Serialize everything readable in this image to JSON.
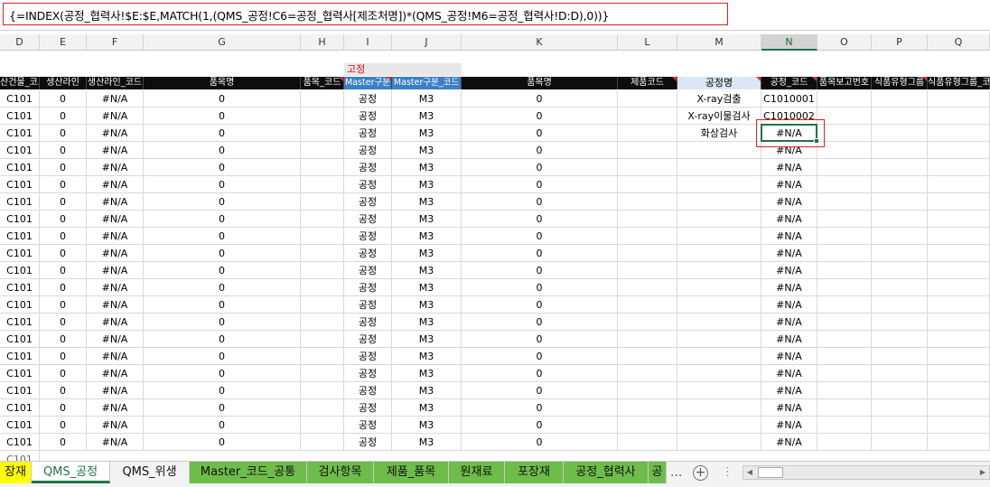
{
  "formula": "{=INDEX(공정_협력사!$E:$E,MATCH(1,(QMS_공정!C6=공정_협력사[제조처명])*(QMS_공정!M6=공정_협력사!D:D),0))}",
  "column_letters": [
    "D",
    "E",
    "F",
    "G",
    "H",
    "I",
    "J",
    "K",
    "L",
    "M",
    "N",
    "O",
    "P",
    "Q"
  ],
  "active_column": "N",
  "fixed_label": "고정",
  "headers": [
    "산건물_코드",
    "생산라인",
    "생산라인_코드",
    "품목명",
    "품목_코드",
    "Master구분",
    "Master구분_코드",
    "품목명",
    "제품코드",
    "공정명",
    "공정_코드",
    "품목보고번호",
    "식품유형그룹",
    "식품유형그룹_코"
  ],
  "row_template": {
    "building_code": "C101",
    "line": "0",
    "line_code": "#N/A",
    "item_name": "0",
    "item_code": "",
    "master_type": "공정",
    "master_code": "M3",
    "item_name2": "0",
    "product_code": "",
    "process_code_default": "#N/A"
  },
  "process_rows": [
    {
      "name": "X-ray검출",
      "code": "C1010001"
    },
    {
      "name": "X-ray이물검사",
      "code": "C1010002"
    },
    {
      "name": "화상검사",
      "code": "#N/A"
    }
  ],
  "row_count": 21,
  "partial_row_text": "C101",
  "sheet_tabs": [
    {
      "label": "장재",
      "style": "yellow"
    },
    {
      "label": "QMS_공정",
      "style": "active"
    },
    {
      "label": "QMS_위생",
      "style": "plain"
    },
    {
      "label": "Master_코드_공통",
      "style": "green"
    },
    {
      "label": "검사항목",
      "style": "green"
    },
    {
      "label": "제품_품목",
      "style": "green"
    },
    {
      "label": "원재료",
      "style": "green"
    },
    {
      "label": "포장재",
      "style": "green"
    },
    {
      "label": "공정_협력사",
      "style": "green"
    },
    {
      "label": "공",
      "style": "green"
    }
  ],
  "tab_more": "...",
  "add_sheet": "+",
  "scroll_left": "◀",
  "scroll_right": "▶",
  "colors": {
    "accent": "#217346",
    "tab_green": "#6ebd4a",
    "highlight": "#e02020"
  }
}
